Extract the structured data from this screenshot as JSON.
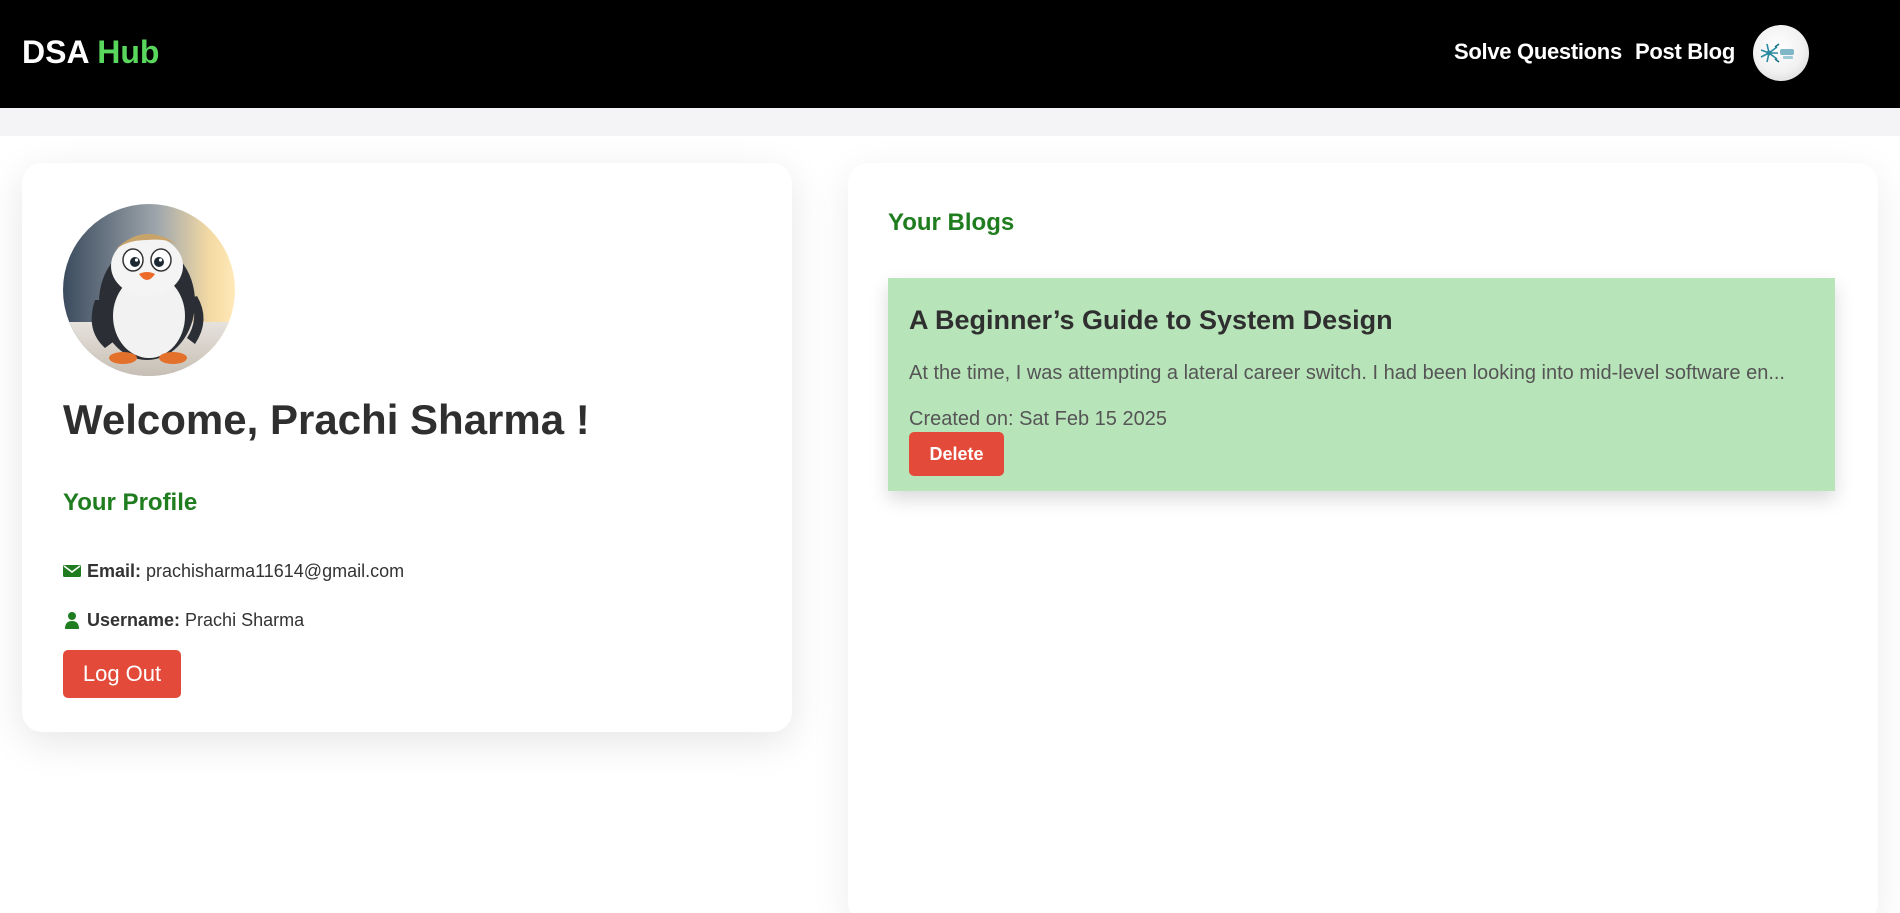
{
  "navbar": {
    "brand_prefix": "DSA",
    "brand_suffix": "Hub",
    "links": [
      "Solve Questions",
      "Post Blog"
    ]
  },
  "profile": {
    "welcome": "Welcome, Prachi Sharma !",
    "section_title": "Your Profile",
    "email_label": "Email:",
    "email": "prachisharma11614@gmail.com",
    "username_label": "Username:",
    "username": "Prachi Sharma",
    "logout_label": "Log Out"
  },
  "blogs": {
    "section_title": "Your Blogs",
    "items": [
      {
        "title": "A Beginner’s Guide to System Design",
        "excerpt": "At the time, I was attempting a lateral career switch. I had been looking into mid-level software en...",
        "created": "Created on: Sat Feb 15 2025",
        "delete_label": "Delete"
      }
    ]
  },
  "colors": {
    "accent_green": "#1f7d1f",
    "brand_green": "#59d65c",
    "danger": "#e34a3a",
    "blog_card": "#b8e4ba"
  }
}
